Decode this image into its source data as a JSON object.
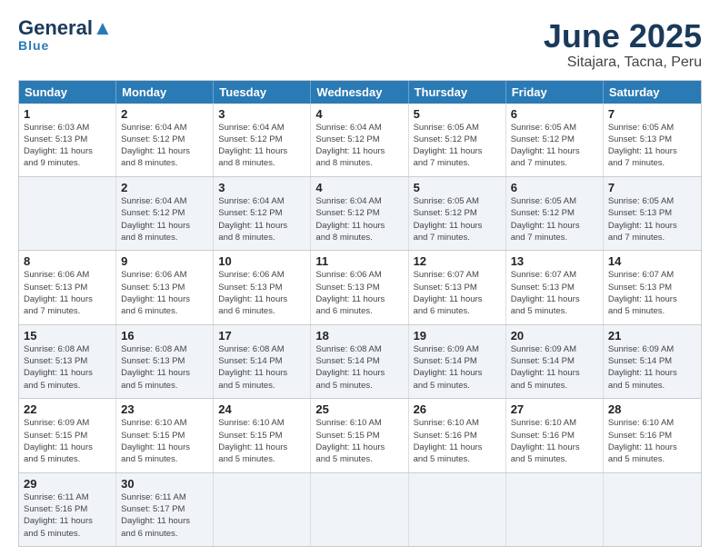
{
  "logo": {
    "line1a": "General",
    "line1b": "Blue",
    "tagline": ""
  },
  "title": "June 2025",
  "subtitle": "Sitajara, Tacna, Peru",
  "days": [
    "Sunday",
    "Monday",
    "Tuesday",
    "Wednesday",
    "Thursday",
    "Friday",
    "Saturday"
  ],
  "rows": [
    [
      {
        "num": "",
        "info": "",
        "empty": true
      },
      {
        "num": "2",
        "info": "Sunrise: 6:04 AM\nSunset: 5:12 PM\nDaylight: 11 hours\nand 8 minutes.",
        "empty": false
      },
      {
        "num": "3",
        "info": "Sunrise: 6:04 AM\nSunset: 5:12 PM\nDaylight: 11 hours\nand 8 minutes.",
        "empty": false
      },
      {
        "num": "4",
        "info": "Sunrise: 6:04 AM\nSunset: 5:12 PM\nDaylight: 11 hours\nand 8 minutes.",
        "empty": false
      },
      {
        "num": "5",
        "info": "Sunrise: 6:05 AM\nSunset: 5:12 PM\nDaylight: 11 hours\nand 7 minutes.",
        "empty": false
      },
      {
        "num": "6",
        "info": "Sunrise: 6:05 AM\nSunset: 5:12 PM\nDaylight: 11 hours\nand 7 minutes.",
        "empty": false
      },
      {
        "num": "7",
        "info": "Sunrise: 6:05 AM\nSunset: 5:13 PM\nDaylight: 11 hours\nand 7 minutes.",
        "empty": false
      }
    ],
    [
      {
        "num": "8",
        "info": "Sunrise: 6:06 AM\nSunset: 5:13 PM\nDaylight: 11 hours\nand 7 minutes.",
        "empty": false
      },
      {
        "num": "9",
        "info": "Sunrise: 6:06 AM\nSunset: 5:13 PM\nDaylight: 11 hours\nand 6 minutes.",
        "empty": false
      },
      {
        "num": "10",
        "info": "Sunrise: 6:06 AM\nSunset: 5:13 PM\nDaylight: 11 hours\nand 6 minutes.",
        "empty": false
      },
      {
        "num": "11",
        "info": "Sunrise: 6:06 AM\nSunset: 5:13 PM\nDaylight: 11 hours\nand 6 minutes.",
        "empty": false
      },
      {
        "num": "12",
        "info": "Sunrise: 6:07 AM\nSunset: 5:13 PM\nDaylight: 11 hours\nand 6 minutes.",
        "empty": false
      },
      {
        "num": "13",
        "info": "Sunrise: 6:07 AM\nSunset: 5:13 PM\nDaylight: 11 hours\nand 5 minutes.",
        "empty": false
      },
      {
        "num": "14",
        "info": "Sunrise: 6:07 AM\nSunset: 5:13 PM\nDaylight: 11 hours\nand 5 minutes.",
        "empty": false
      }
    ],
    [
      {
        "num": "15",
        "info": "Sunrise: 6:08 AM\nSunset: 5:13 PM\nDaylight: 11 hours\nand 5 minutes.",
        "empty": false
      },
      {
        "num": "16",
        "info": "Sunrise: 6:08 AM\nSunset: 5:13 PM\nDaylight: 11 hours\nand 5 minutes.",
        "empty": false
      },
      {
        "num": "17",
        "info": "Sunrise: 6:08 AM\nSunset: 5:14 PM\nDaylight: 11 hours\nand 5 minutes.",
        "empty": false
      },
      {
        "num": "18",
        "info": "Sunrise: 6:08 AM\nSunset: 5:14 PM\nDaylight: 11 hours\nand 5 minutes.",
        "empty": false
      },
      {
        "num": "19",
        "info": "Sunrise: 6:09 AM\nSunset: 5:14 PM\nDaylight: 11 hours\nand 5 minutes.",
        "empty": false
      },
      {
        "num": "20",
        "info": "Sunrise: 6:09 AM\nSunset: 5:14 PM\nDaylight: 11 hours\nand 5 minutes.",
        "empty": false
      },
      {
        "num": "21",
        "info": "Sunrise: 6:09 AM\nSunset: 5:14 PM\nDaylight: 11 hours\nand 5 minutes.",
        "empty": false
      }
    ],
    [
      {
        "num": "22",
        "info": "Sunrise: 6:09 AM\nSunset: 5:15 PM\nDaylight: 11 hours\nand 5 minutes.",
        "empty": false
      },
      {
        "num": "23",
        "info": "Sunrise: 6:10 AM\nSunset: 5:15 PM\nDaylight: 11 hours\nand 5 minutes.",
        "empty": false
      },
      {
        "num": "24",
        "info": "Sunrise: 6:10 AM\nSunset: 5:15 PM\nDaylight: 11 hours\nand 5 minutes.",
        "empty": false
      },
      {
        "num": "25",
        "info": "Sunrise: 6:10 AM\nSunset: 5:15 PM\nDaylight: 11 hours\nand 5 minutes.",
        "empty": false
      },
      {
        "num": "26",
        "info": "Sunrise: 6:10 AM\nSunset: 5:16 PM\nDaylight: 11 hours\nand 5 minutes.",
        "empty": false
      },
      {
        "num": "27",
        "info": "Sunrise: 6:10 AM\nSunset: 5:16 PM\nDaylight: 11 hours\nand 5 minutes.",
        "empty": false
      },
      {
        "num": "28",
        "info": "Sunrise: 6:10 AM\nSunset: 5:16 PM\nDaylight: 11 hours\nand 5 minutes.",
        "empty": false
      }
    ],
    [
      {
        "num": "29",
        "info": "Sunrise: 6:11 AM\nSunset: 5:16 PM\nDaylight: 11 hours\nand 5 minutes.",
        "empty": false
      },
      {
        "num": "30",
        "info": "Sunrise: 6:11 AM\nSunset: 5:17 PM\nDaylight: 11 hours\nand 6 minutes.",
        "empty": false
      },
      {
        "num": "",
        "info": "",
        "empty": true
      },
      {
        "num": "",
        "info": "",
        "empty": true
      },
      {
        "num": "",
        "info": "",
        "empty": true
      },
      {
        "num": "",
        "info": "",
        "empty": true
      },
      {
        "num": "",
        "info": "",
        "empty": true
      }
    ]
  ],
  "row0_extra": [
    {
      "num": "1",
      "info": "Sunrise: 6:03 AM\nSunset: 5:13 PM\nDaylight: 11 hours\nand 9 minutes."
    }
  ]
}
